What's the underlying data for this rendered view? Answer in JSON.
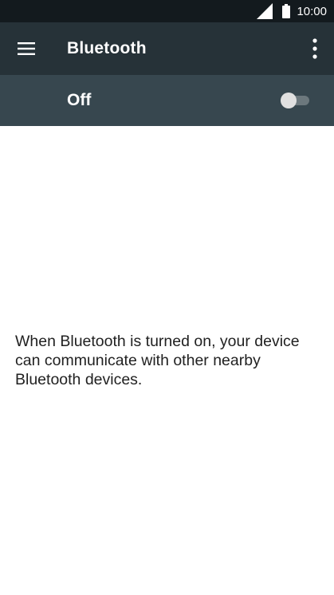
{
  "status_bar": {
    "time": "10:00",
    "signal_icon": "cell-signal-icon",
    "battery_icon": "battery-icon"
  },
  "app_bar": {
    "menu_icon": "menu-icon",
    "title": "Bluetooth",
    "more_icon": "more-vert-icon"
  },
  "toggle_bar": {
    "state_label": "Off",
    "switch_on": false
  },
  "content": {
    "description": "When Bluetooth is turned on, your device can communicate with other nearby Bluetooth devices."
  },
  "colors": {
    "status_bar_bg": "#131a1e",
    "app_bar_bg": "#263238",
    "toggle_bar_bg": "#37474f",
    "switch_thumb": "#e0e0e0",
    "switch_track": "#6c787d",
    "text_primary": "#212121"
  }
}
